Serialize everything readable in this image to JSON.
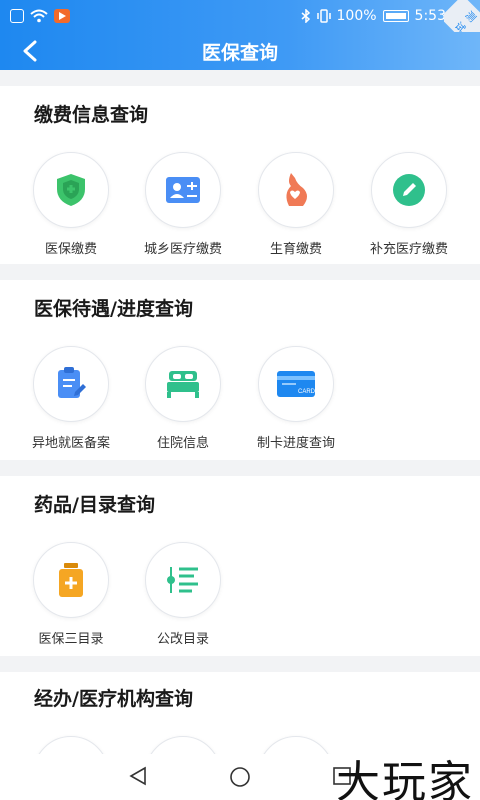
{
  "status_bar": {
    "battery": "100%",
    "time": "5:53",
    "corner_badge": "测试"
  },
  "header": {
    "title": "医保查询"
  },
  "sections": [
    {
      "title": "缴费信息查询",
      "items": [
        {
          "label": "医保缴费",
          "icon": "shield-icon",
          "color": "#3cc36b"
        },
        {
          "label": "城乡医疗缴费",
          "icon": "id-card-icon",
          "color": "#4a8ef5"
        },
        {
          "label": "生育缴费",
          "icon": "pregnancy-icon",
          "color": "#f07a56"
        },
        {
          "label": "补充医疗缴费",
          "icon": "pencil-icon",
          "color": "#2fc08c"
        }
      ]
    },
    {
      "title": "医保待遇/进度查询",
      "items": [
        {
          "label": "异地就医备案",
          "icon": "clipboard-edit-icon",
          "color": "#4a8ef5"
        },
        {
          "label": "住院信息",
          "icon": "hospital-bed-icon",
          "color": "#2fc08c"
        },
        {
          "label": "制卡进度查询",
          "icon": "card-icon",
          "color": "#1e88f0",
          "card_text": "CARD"
        }
      ]
    },
    {
      "title": "药品/目录查询",
      "items": [
        {
          "label": "医保三目录",
          "icon": "medicine-bottle-icon",
          "color": "#f5a623"
        },
        {
          "label": "公改目录",
          "icon": "list-icon",
          "color": "#2fc08c"
        }
      ]
    },
    {
      "title": "经办/医疗机构查询",
      "items": []
    }
  ],
  "watermark": "大玩家"
}
